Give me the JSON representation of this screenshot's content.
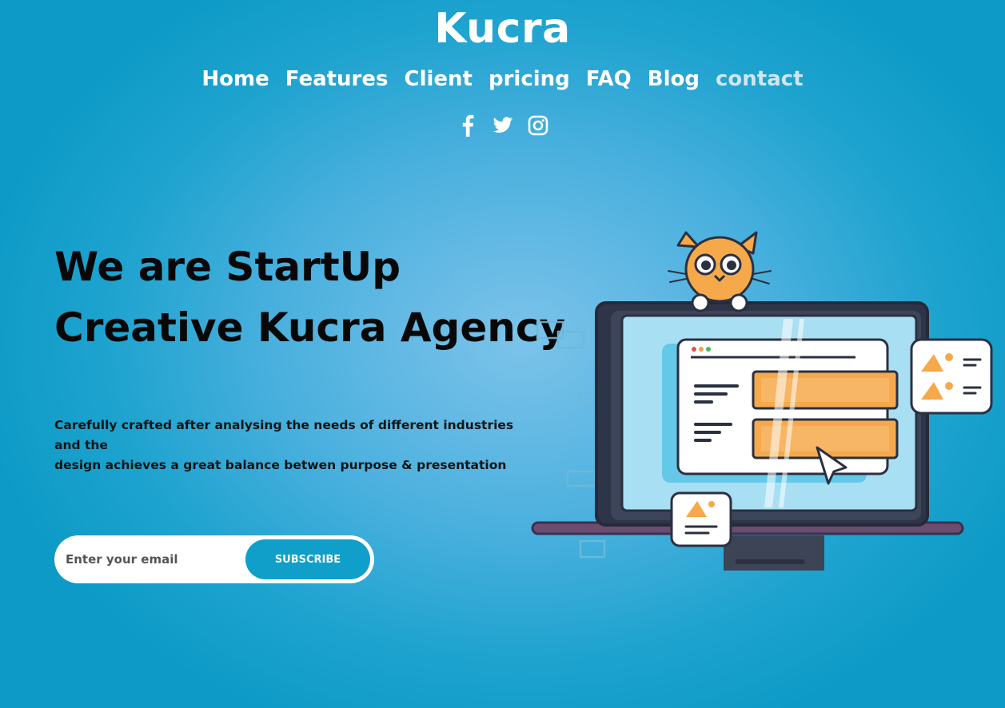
{
  "header": {
    "brand": "Kucra",
    "nav": [
      "Home",
      "Features",
      "Client",
      "pricing",
      "FAQ",
      "Blog",
      "contact"
    ],
    "active_nav": "contact",
    "social_icons": [
      "facebook-icon",
      "twitter-icon",
      "instagram-icon"
    ]
  },
  "hero": {
    "title_line1": "We are StartUp",
    "title_line2": "Creative Kucra Agency",
    "description_line1": "Carefully crafted after analysing the needs of different industries and the",
    "description_line2": "design achieves a great balance betwen purpose & presentation"
  },
  "subscribe": {
    "placeholder": "Enter your email",
    "button_label": "SUBSCRIBE"
  },
  "colors": {
    "background_center": "#7cc3ea",
    "background_edge": "#0d9ac6",
    "button": "#0f9fc9",
    "illustration_accent": "#f6a94a"
  }
}
